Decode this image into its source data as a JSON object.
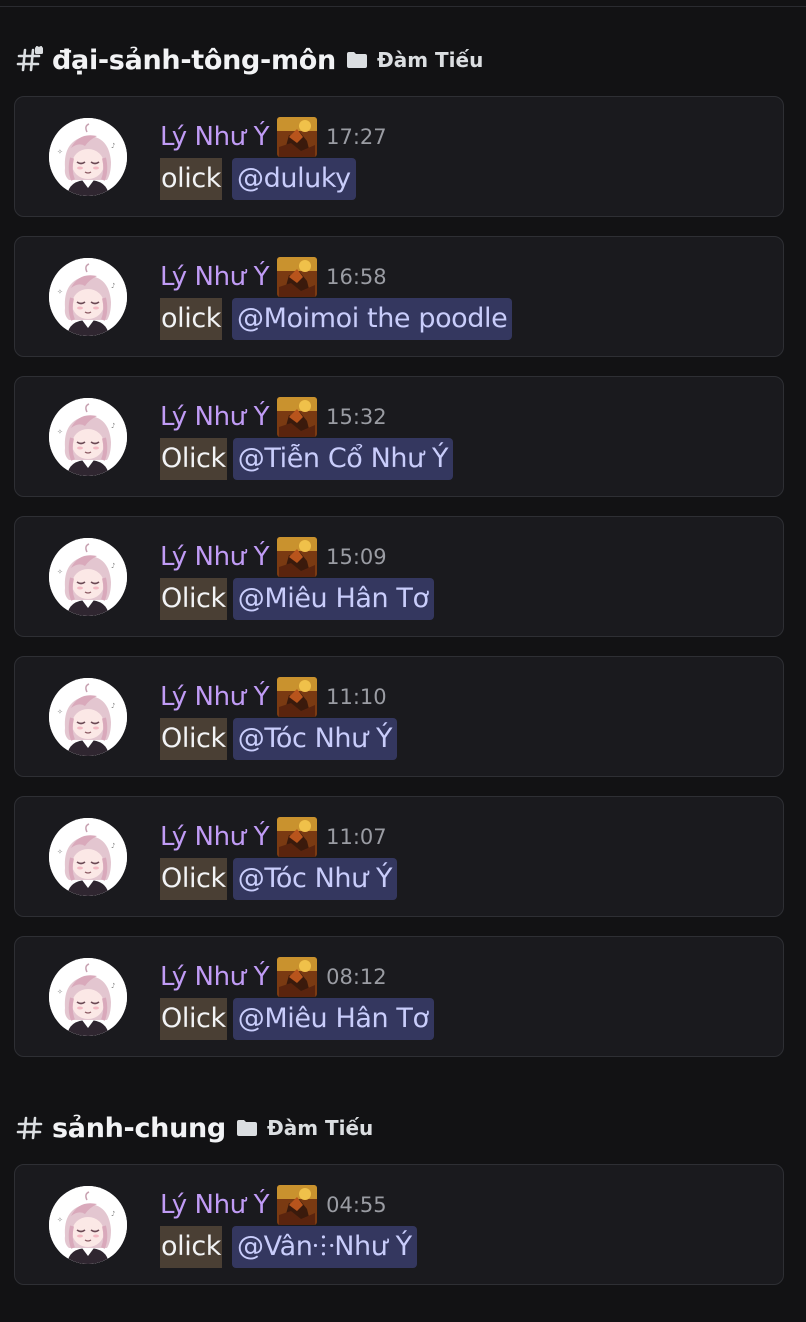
{
  "sections": [
    {
      "channel": "đại-sảnh-tông-môn",
      "category": "Đàm Tiếu",
      "messages": [
        {
          "author": "Lý Như Ý",
          "time": "17:27",
          "text": "olick",
          "mention": "@duluky"
        },
        {
          "author": "Lý Như Ý",
          "time": "16:58",
          "text": "olick",
          "mention": "@Moimoi the poodle"
        },
        {
          "author": "Lý Như Ý",
          "time": "15:32",
          "text": "Olick",
          "mention": "@Tiễn Cổ Như Ý"
        },
        {
          "author": "Lý Như Ý",
          "time": "15:09",
          "text": "Olick",
          "mention": "@Miêu Hân Tơ"
        },
        {
          "author": "Lý Như Ý",
          "time": "11:10",
          "text": "Olick",
          "mention": "@Tóc Như Ý"
        },
        {
          "author": "Lý Như Ý",
          "time": "11:07",
          "text": "Olick",
          "mention": "@Tóc Như Ý"
        },
        {
          "author": "Lý Như Ý",
          "time": "08:12",
          "text": "Olick",
          "mention": "@Miêu Hân Tơ"
        }
      ]
    },
    {
      "channel": "sảnh-chung",
      "category": "Đàm Tiếu",
      "messages": [
        {
          "author": "Lý Như Ý",
          "time": "04:55",
          "text": "olick",
          "mention": "@Vân⸭Như  Ý"
        }
      ]
    }
  ],
  "colors": {
    "background": "#121214",
    "card": "#1a1a1e",
    "author": "#c09bf5",
    "mention_bg": "#34375f",
    "mention_text": "#c9cdfb",
    "highlight_bg": "#4a3f34"
  },
  "icons": {
    "channel": "text-channel-hash-icon",
    "category": "folder-icon",
    "avatar": "anime-girl-avatar",
    "badge": "role-badge-icon"
  }
}
